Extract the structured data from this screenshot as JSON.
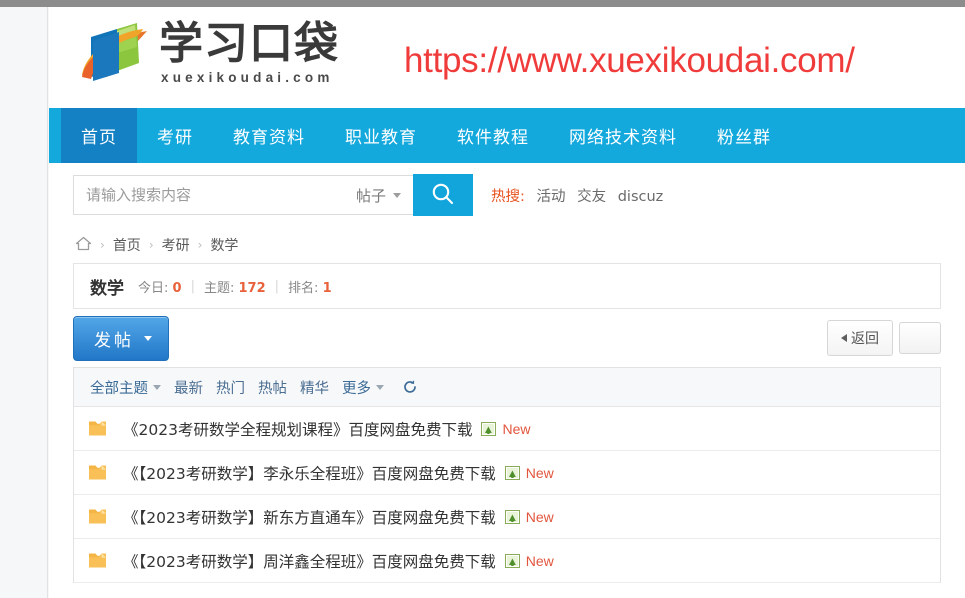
{
  "site": {
    "logo_cn": "学习口袋",
    "logo_en": "xuexikoudai.com",
    "watermark_url": "https://www.xuexikoudai.com/"
  },
  "nav": {
    "items": [
      {
        "label": "首页",
        "active": true
      },
      {
        "label": "考研",
        "active": false
      },
      {
        "label": "教育资料",
        "active": false
      },
      {
        "label": "职业教育",
        "active": false
      },
      {
        "label": "软件教程",
        "active": false
      },
      {
        "label": "网络技术资料",
        "active": false
      },
      {
        "label": "粉丝群",
        "active": false
      }
    ]
  },
  "search": {
    "placeholder": "请输入搜索内容",
    "value": "",
    "type_label": "帖子",
    "button_icon": "search-icon",
    "hot_label": "热搜:",
    "hot_links": [
      "活动",
      "交友",
      "discuz"
    ]
  },
  "breadcrumb": {
    "home_icon": "home-icon",
    "items": [
      "首页",
      "考研",
      "数学"
    ],
    "separator": "›"
  },
  "forum": {
    "name": "数学",
    "stats": [
      {
        "label": "今日:",
        "value": "0"
      },
      {
        "label": "主题:",
        "value": "172"
      },
      {
        "label": "排名:",
        "value": "1"
      }
    ]
  },
  "toolbar": {
    "post_label": "发帖",
    "back_label": "返回"
  },
  "filters": {
    "all_topics": "全部主题",
    "items": [
      "最新",
      "热门",
      "热帖",
      "精华"
    ],
    "more": "更多",
    "refresh_icon": "refresh-icon"
  },
  "threads": [
    {
      "icon": "folder-icon",
      "title": "《2023考研数学全程规划课程》百度网盘免费下载",
      "attachment_icon": "image-attachment-icon",
      "badge": "New"
    },
    {
      "icon": "folder-icon",
      "title": "《【2023考研数学】李永乐全程班》百度网盘免费下载",
      "attachment_icon": "image-attachment-icon",
      "badge": "New"
    },
    {
      "icon": "folder-icon",
      "title": "《【2023考研数学】新东方直通车》百度网盘免费下载",
      "attachment_icon": "image-attachment-icon",
      "badge": "New"
    },
    {
      "icon": "folder-icon",
      "title": "《【2023考研数学】周洋鑫全程班》百度网盘免费下载",
      "attachment_icon": "image-attachment-icon",
      "badge": "New"
    }
  ],
  "colors": {
    "nav_bg": "#14a9dd",
    "nav_active": "#1481c4",
    "accent_red": "#f03b3b",
    "stat_orange": "#e8613b",
    "hot_orange": "#e8521f",
    "link_blue": "#3a6a96"
  }
}
